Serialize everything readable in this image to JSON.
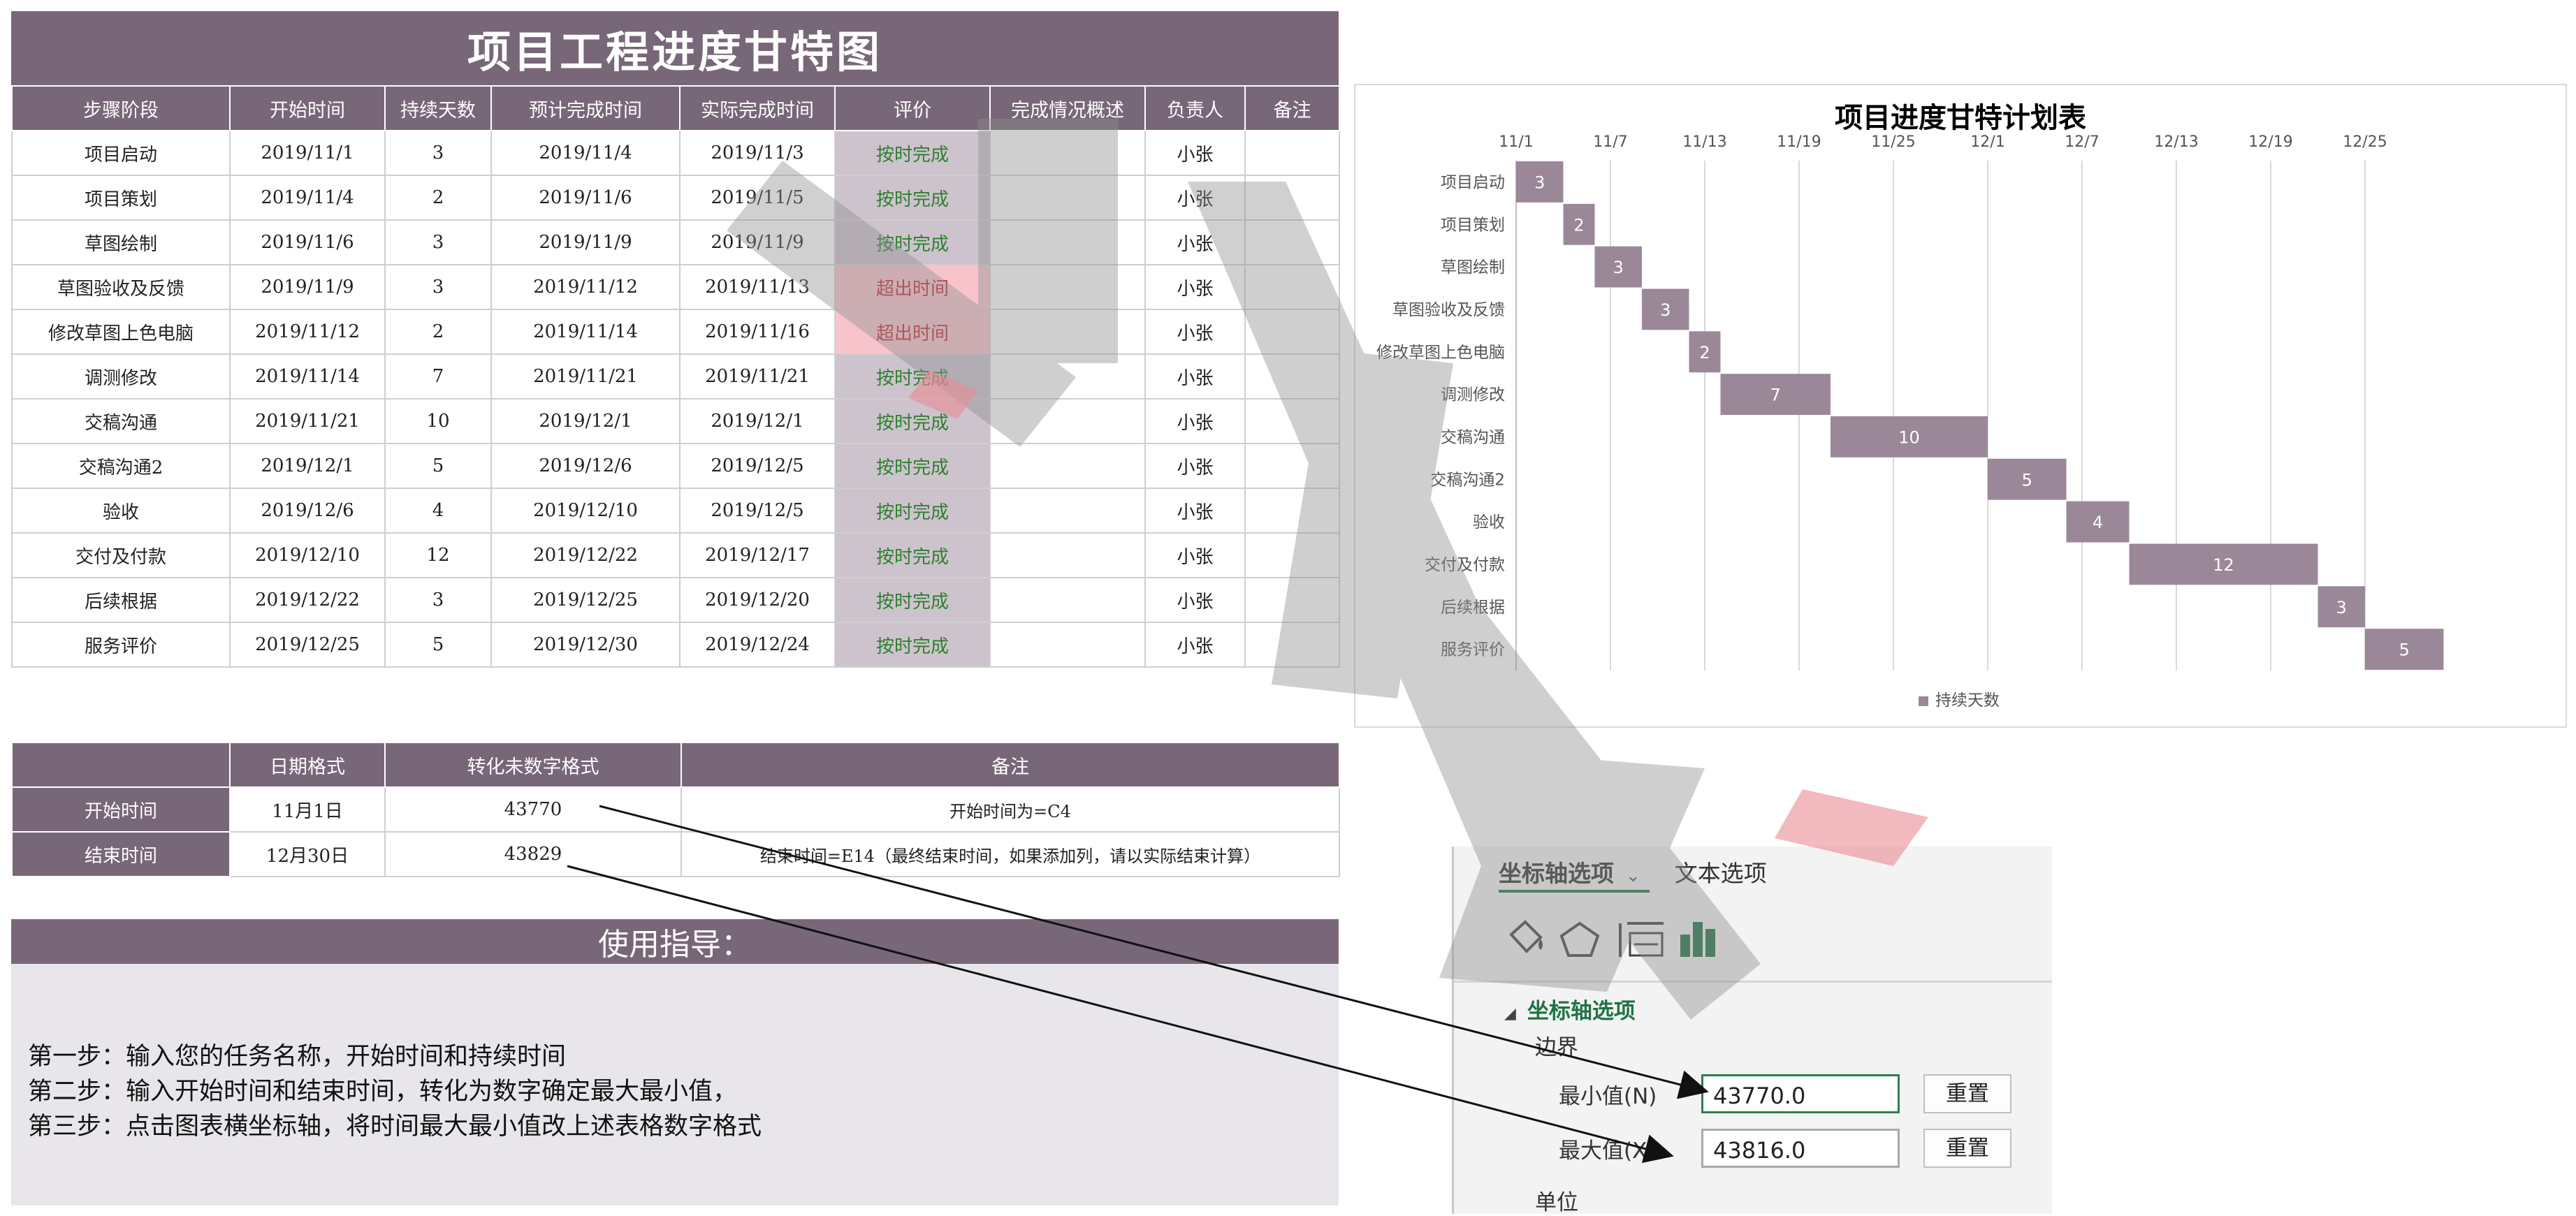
{
  "main": {
    "title": "项目工程进度甘特图",
    "headers": [
      "步骤阶段",
      "开始时间",
      "持续天数",
      "预计完成时间",
      "实际完成时间",
      "评价",
      "完成情况概述",
      "负责人",
      "备注"
    ],
    "rows": [
      {
        "stage": "项目启动",
        "start": "2019/11/1",
        "days": "3",
        "planned": "2019/11/4",
        "actual": "2019/11/3",
        "eval": "按时完成",
        "status": "ok",
        "summary": "",
        "owner": "小张",
        "note": ""
      },
      {
        "stage": "项目策划",
        "start": "2019/11/4",
        "days": "2",
        "planned": "2019/11/6",
        "actual": "2019/11/5",
        "eval": "按时完成",
        "status": "ok",
        "summary": "",
        "owner": "小张",
        "note": ""
      },
      {
        "stage": "草图绘制",
        "start": "2019/11/6",
        "days": "3",
        "planned": "2019/11/9",
        "actual": "2019/11/9",
        "eval": "按时完成",
        "status": "ok",
        "summary": "",
        "owner": "小张",
        "note": ""
      },
      {
        "stage": "草图验收及反馈",
        "start": "2019/11/9",
        "days": "3",
        "planned": "2019/11/12",
        "actual": "2019/11/13",
        "eval": "超出时间",
        "status": "late",
        "summary": "",
        "owner": "小张",
        "note": ""
      },
      {
        "stage": "修改草图上色电脑",
        "start": "2019/11/12",
        "days": "2",
        "planned": "2019/11/14",
        "actual": "2019/11/16",
        "eval": "超出时间",
        "status": "late",
        "summary": "",
        "owner": "小张",
        "note": ""
      },
      {
        "stage": "调测修改",
        "start": "2019/11/14",
        "days": "7",
        "planned": "2019/11/21",
        "actual": "2019/11/21",
        "eval": "按时完成",
        "status": "ok",
        "summary": "",
        "owner": "小张",
        "note": ""
      },
      {
        "stage": "交稿沟通",
        "start": "2019/11/21",
        "days": "10",
        "planned": "2019/12/1",
        "actual": "2019/12/1",
        "eval": "按时完成",
        "status": "ok",
        "summary": "",
        "owner": "小张",
        "note": ""
      },
      {
        "stage": "交稿沟通2",
        "start": "2019/12/1",
        "days": "5",
        "planned": "2019/12/6",
        "actual": "2019/12/5",
        "eval": "按时完成",
        "status": "ok",
        "summary": "",
        "owner": "小张",
        "note": ""
      },
      {
        "stage": "验收",
        "start": "2019/12/6",
        "days": "4",
        "planned": "2019/12/10",
        "actual": "2019/12/5",
        "eval": "按时完成",
        "status": "ok",
        "summary": "",
        "owner": "小张",
        "note": ""
      },
      {
        "stage": "交付及付款",
        "start": "2019/12/10",
        "days": "12",
        "planned": "2019/12/22",
        "actual": "2019/12/17",
        "eval": "按时完成",
        "status": "ok",
        "summary": "",
        "owner": "小张",
        "note": ""
      },
      {
        "stage": "后续根据",
        "start": "2019/12/22",
        "days": "3",
        "planned": "2019/12/25",
        "actual": "2019/12/20",
        "eval": "按时完成",
        "status": "ok",
        "summary": "",
        "owner": "小张",
        "note": ""
      },
      {
        "stage": "服务评价",
        "start": "2019/12/25",
        "days": "5",
        "planned": "2019/12/30",
        "actual": "2019/12/24",
        "eval": "按时完成",
        "status": "ok",
        "summary": "",
        "owner": "小张",
        "note": ""
      }
    ]
  },
  "date_table": {
    "headers": [
      "",
      "日期格式",
      "转化未数字格式",
      "备注"
    ],
    "rows": [
      {
        "label": "开始时间",
        "date": "11月1日",
        "number": "43770",
        "note": "开始时间为=C4"
      },
      {
        "label": "结束时间",
        "date": "12月30日",
        "number": "43829",
        "note": "结束时间=E14（最终结束时间，如果添加列，请以实际结束计算）"
      }
    ]
  },
  "guide": {
    "title": "使用指导：",
    "steps": [
      "第一步：输入您的任务名称，开始时间和持续时间",
      "第二步：输入开始时间和结束时间，转化为数字确定最大最小值，",
      "第三步：点击图表横坐标轴，将时间最大最小值改上述表格数字格式"
    ]
  },
  "chart_data": {
    "type": "bar",
    "orientation": "horizontal-stacked-gantt",
    "title": "项目进度甘特计划表",
    "x_ticks": [
      "11/1",
      "11/7",
      "11/13",
      "11/19",
      "11/25",
      "12/1",
      "12/7",
      "12/13",
      "12/19",
      "12/25"
    ],
    "x_tick_values": [
      "2019-11-01",
      "2019-11-07",
      "2019-11-13",
      "2019-11-19",
      "2019-11-25",
      "2019-12-01",
      "2019-12-07",
      "2019-12-13",
      "2019-12-19",
      "2019-12-25"
    ],
    "xlim": [
      "2019-11-01",
      "2019-12-25"
    ],
    "categories": [
      "项目启动",
      "项目策划",
      "草图绘制",
      "草图验收及反馈",
      "修改草图上色电脑",
      "调测修改",
      "交稿沟通",
      "交稿沟通2",
      "验收",
      "交付及付款",
      "后续根据",
      "服务评价"
    ],
    "starts": [
      "2019-11-01",
      "2019-11-04",
      "2019-11-06",
      "2019-11-09",
      "2019-11-12",
      "2019-11-14",
      "2019-11-21",
      "2019-12-01",
      "2019-12-06",
      "2019-12-10",
      "2019-12-22",
      "2019-12-25"
    ],
    "series": [
      {
        "name": "持续天数",
        "values": [
          3,
          2,
          3,
          3,
          2,
          7,
          10,
          5,
          4,
          12,
          3,
          5
        ]
      }
    ],
    "legend_position": "bottom",
    "bar_color": "#9a8898",
    "grid": "vertical"
  },
  "axis_panel": {
    "tab_axis": "坐标轴选项",
    "tab_text": "文本选项",
    "section": "坐标轴选项",
    "bounds": "边界",
    "min_label": "最小值(N)",
    "min_value": "43770.0",
    "max_label": "最大值(X)",
    "max_value": "43816.0",
    "reset": "重置",
    "unit": "单位",
    "accent": "#217346"
  }
}
